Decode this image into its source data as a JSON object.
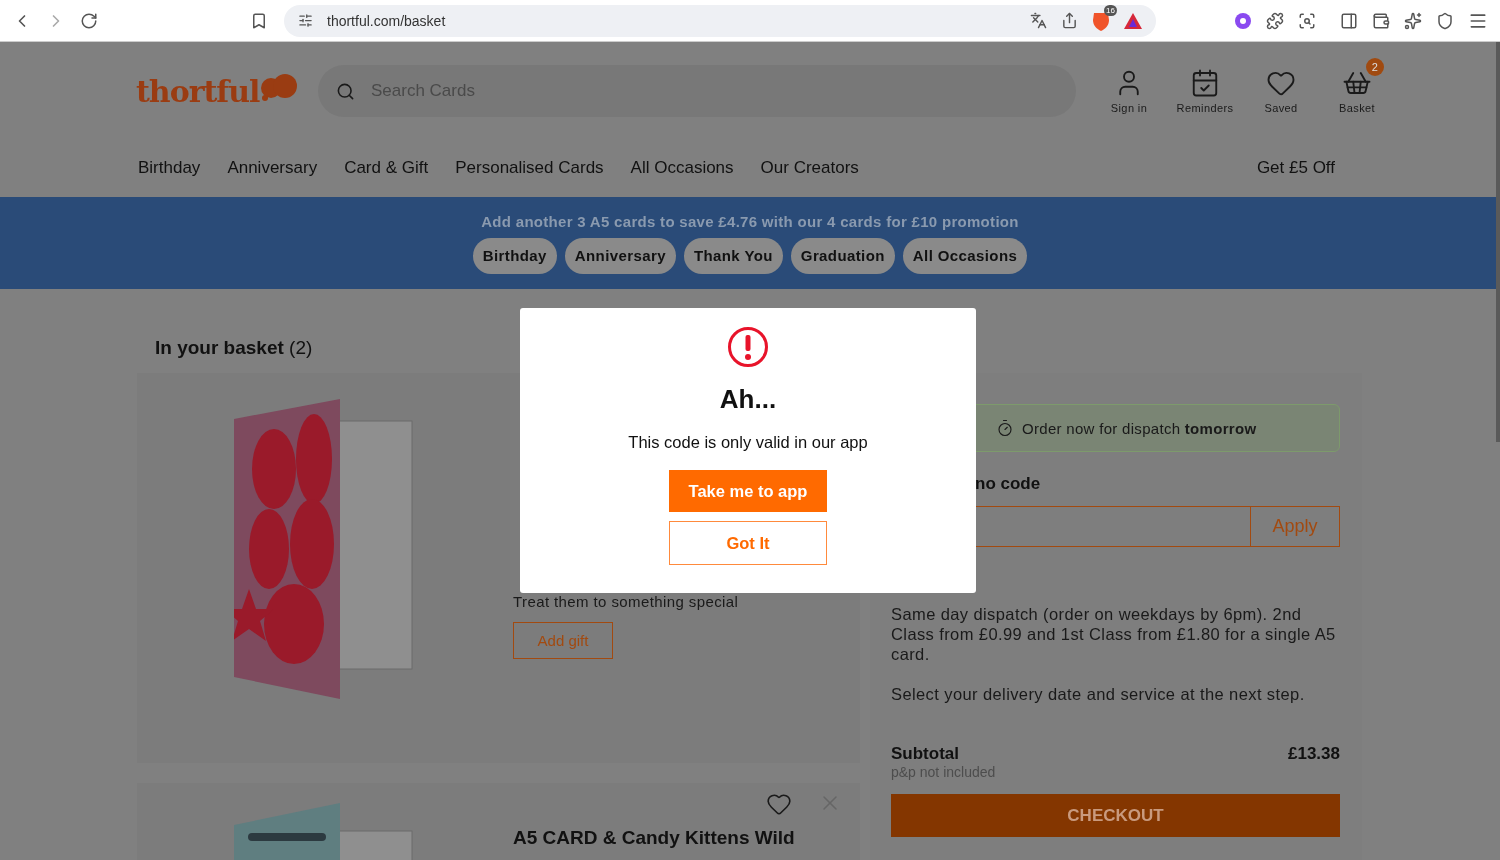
{
  "browser": {
    "url": "thortful.com/basket",
    "shield_badge": "16"
  },
  "header": {
    "logo": "thortful",
    "search": {
      "placeholder": "Search Cards"
    },
    "actions": [
      {
        "kind": "user",
        "label": "Sign in"
      },
      {
        "kind": "calendar",
        "label": "Reminders"
      },
      {
        "kind": "heart",
        "label": "Saved"
      },
      {
        "kind": "basket",
        "label": "Basket",
        "badge": "2"
      }
    ]
  },
  "nav": {
    "items": [
      "Birthday",
      "Anniversary",
      "Card & Gift",
      "Personalised Cards",
      "All Occasions",
      "Our Creators"
    ],
    "offer": "Get £5 Off"
  },
  "promo_banner": {
    "text": "Add another 3 A5 cards to save £4.76 with our 4 cards for £10 promotion",
    "chips": [
      "Birthday",
      "Anniversary",
      "Thank You",
      "Graduation",
      "All Occasions"
    ]
  },
  "basket": {
    "title": "In your basket",
    "count": "(2)",
    "items": [
      {
        "kind": "full",
        "gift_text": "Treat them to something special",
        "gift_button": "Add gift"
      },
      {
        "kind": "partial",
        "title": "A5 CARD & Candy Kittens Wild"
      }
    ]
  },
  "summary": {
    "dispatch": "Order now for dispatch **tomorrow**",
    "promo_label": "no code",
    "apply": "Apply",
    "delivery": [
      "Same day dispatch (order on weekdays by 6pm). 2nd Class from £0.99 and 1st Class from £1.80 for a single A5 card.",
      "Select your delivery date and service at the next step."
    ],
    "subtotal_label": "Subtotal",
    "subtotal": "£13.38",
    "subtotal_note": "p&p not included",
    "checkout": "CHECKOUT"
  },
  "modal": {
    "title": "Ah...",
    "message": "This code is only valid in our app",
    "primary": "Take me to app",
    "secondary": "Got It"
  }
}
